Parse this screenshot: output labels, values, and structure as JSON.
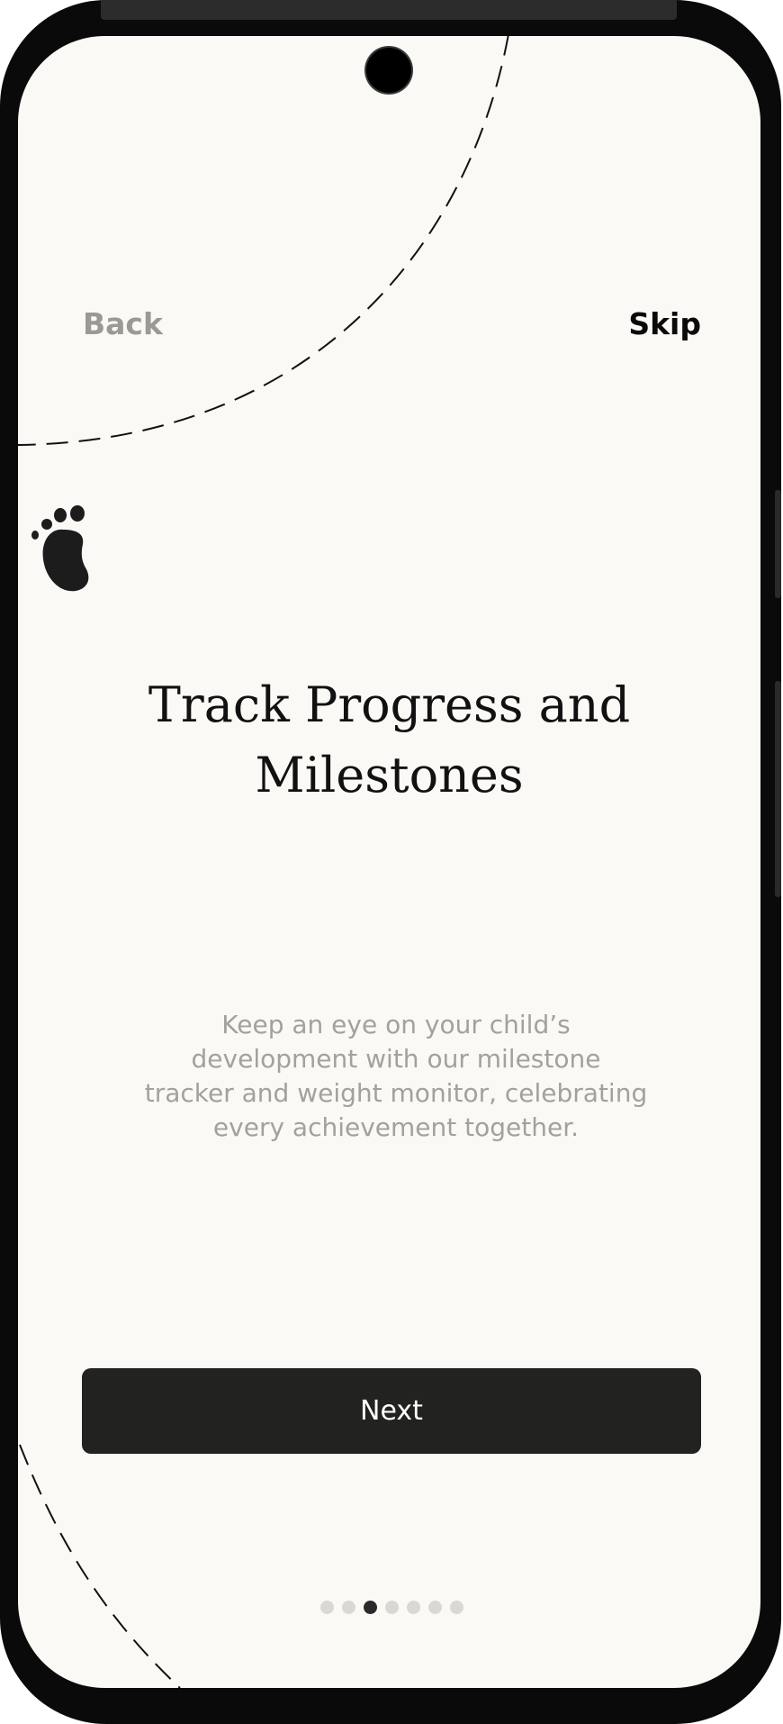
{
  "nav": {
    "back_label": "Back",
    "skip_label": "Skip"
  },
  "onboarding": {
    "title_line1": "Track Progress and",
    "title_line2": "Milestones",
    "description": "Keep an eye on your child’s development with our milestone tracker and weight monitor, celebrating every achievement together.",
    "next_label": "Next",
    "page_count": 7,
    "current_page": 3
  },
  "icons": {
    "decoration": "footprint-icon"
  },
  "colors": {
    "background": "#fbf9f5",
    "button": "#222221",
    "muted_text": "#a3a09d",
    "dot_active": "#2a2a2a",
    "dot_inactive": "#d9d8d5"
  }
}
